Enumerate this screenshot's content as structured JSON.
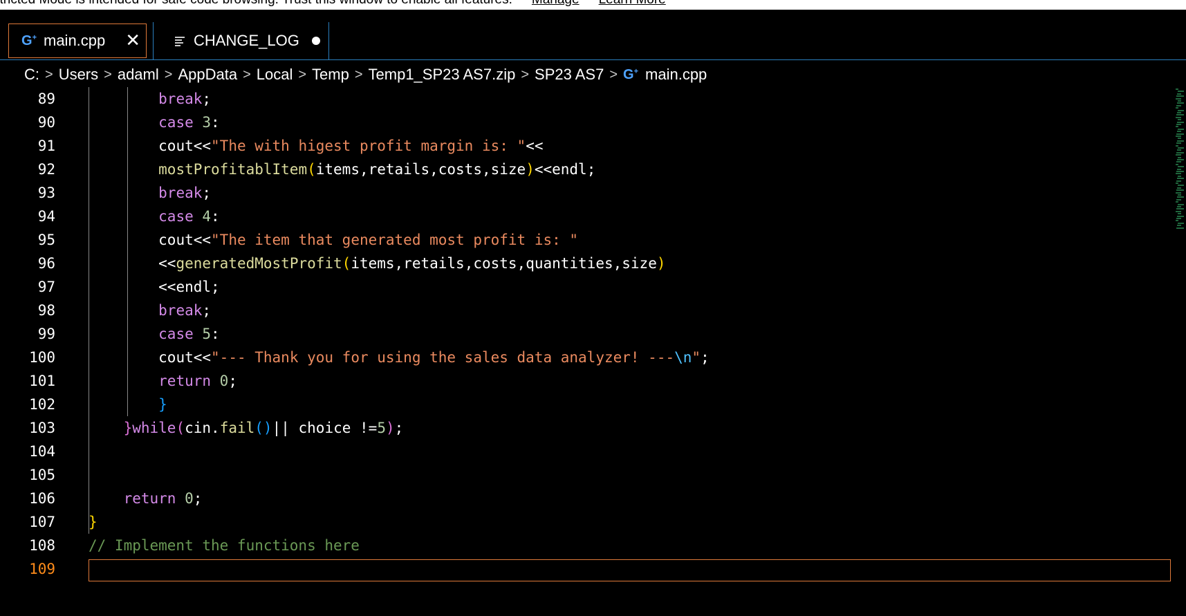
{
  "banner": {
    "message": "stricted Mode is intended for safe code browsing. Trust this window to enable all features.",
    "manage": "Manage",
    "learn_more": "Learn More"
  },
  "tabs": [
    {
      "label": "main.cpp",
      "icon": "cpp-file-icon",
      "active": true,
      "close": "✕"
    },
    {
      "label": "CHANGE_LOG",
      "icon": "text-lines-icon",
      "dirty": true
    }
  ],
  "breadcrumb": [
    "C:",
    "Users",
    "adaml",
    "AppData",
    "Local",
    "Temp",
    "Temp1_SP23 AS7.zip",
    "SP23 AS7",
    "main.cpp"
  ],
  "colors": {
    "accent_orange": "#e07a3a",
    "border_blue": "#2b7fbf",
    "keyword": "#d48ae8",
    "string": "#ea8a5f",
    "comment": "#6a9955"
  },
  "editor": {
    "current_line": 109,
    "lines": [
      {
        "n": "89",
        "tokens": [
          [
            "        ",
            "plain"
          ],
          [
            "break",
            "kw"
          ],
          [
            ";",
            "plain"
          ]
        ]
      },
      {
        "n": "90",
        "tokens": [
          [
            "        ",
            "plain"
          ],
          [
            "case",
            "kw"
          ],
          [
            " ",
            "plain"
          ],
          [
            "3",
            "num"
          ],
          [
            ":",
            "plain"
          ]
        ]
      },
      {
        "n": "91",
        "tokens": [
          [
            "        ",
            "plain"
          ],
          [
            "cout",
            "plain"
          ],
          [
            "<<",
            "plain"
          ],
          [
            "\"The with higest profit margin is: \"",
            "str"
          ],
          [
            "<<",
            "plain"
          ]
        ]
      },
      {
        "n": "92",
        "tokens": [
          [
            "        ",
            "plain"
          ],
          [
            "mostProfitablItem",
            "fn"
          ],
          [
            "(",
            "brace-y"
          ],
          [
            "items,retails,costs,size",
            "plain"
          ],
          [
            ")",
            "brace-y"
          ],
          [
            "<<endl;",
            "plain"
          ]
        ]
      },
      {
        "n": "93",
        "tokens": [
          [
            "        ",
            "plain"
          ],
          [
            "break",
            "kw"
          ],
          [
            ";",
            "plain"
          ]
        ]
      },
      {
        "n": "94",
        "tokens": [
          [
            "        ",
            "plain"
          ],
          [
            "case",
            "kw"
          ],
          [
            " ",
            "plain"
          ],
          [
            "4",
            "num"
          ],
          [
            ":",
            "plain"
          ]
        ]
      },
      {
        "n": "95",
        "tokens": [
          [
            "        ",
            "plain"
          ],
          [
            "cout",
            "plain"
          ],
          [
            "<<",
            "plain"
          ],
          [
            "\"The item that generated most profit is: \"",
            "str"
          ]
        ]
      },
      {
        "n": "96",
        "tokens": [
          [
            "        ",
            "plain"
          ],
          [
            "<<",
            "plain"
          ],
          [
            "generatedMostProfit",
            "fn"
          ],
          [
            "(",
            "brace-y"
          ],
          [
            "items,retails,costs,quantities,size",
            "plain"
          ],
          [
            ")",
            "brace-y"
          ]
        ]
      },
      {
        "n": "97",
        "tokens": [
          [
            "        ",
            "plain"
          ],
          [
            "<<endl;",
            "plain"
          ]
        ]
      },
      {
        "n": "98",
        "tokens": [
          [
            "        ",
            "plain"
          ],
          [
            "break",
            "kw"
          ],
          [
            ";",
            "plain"
          ]
        ]
      },
      {
        "n": "99",
        "tokens": [
          [
            "        ",
            "plain"
          ],
          [
            "case",
            "kw"
          ],
          [
            " ",
            "plain"
          ],
          [
            "5",
            "num"
          ],
          [
            ":",
            "plain"
          ]
        ]
      },
      {
        "n": "100",
        "tokens": [
          [
            "        ",
            "plain"
          ],
          [
            "cout",
            "plain"
          ],
          [
            "<<",
            "plain"
          ],
          [
            "\"--- Thank you for using the sales data analyzer! ---",
            "str"
          ],
          [
            "\\n",
            "esc"
          ],
          [
            "\"",
            "str"
          ],
          [
            ";",
            "plain"
          ]
        ]
      },
      {
        "n": "101",
        "tokens": [
          [
            "        ",
            "plain"
          ],
          [
            "return",
            "kw"
          ],
          [
            " ",
            "plain"
          ],
          [
            "0",
            "num"
          ],
          [
            ";",
            "plain"
          ]
        ]
      },
      {
        "n": "102",
        "tokens": [
          [
            "        ",
            "plain"
          ],
          [
            "}",
            "brace-b"
          ]
        ]
      },
      {
        "n": "103",
        "tokens": [
          [
            "    ",
            "plain"
          ],
          [
            "}",
            "brace-p"
          ],
          [
            "while",
            "kw"
          ],
          [
            "(",
            "brace-p"
          ],
          [
            "cin",
            "plain"
          ],
          [
            ".",
            "plain"
          ],
          [
            "fail",
            "fn"
          ],
          [
            "()",
            "brace-b"
          ],
          [
            "||",
            "plain"
          ],
          [
            " choice !=",
            "plain"
          ],
          [
            "5",
            "num"
          ],
          [
            ")",
            "brace-p"
          ],
          [
            ";",
            "plain"
          ]
        ]
      },
      {
        "n": "104",
        "tokens": []
      },
      {
        "n": "105",
        "tokens": []
      },
      {
        "n": "106",
        "tokens": [
          [
            "    ",
            "plain"
          ],
          [
            "return",
            "kw"
          ],
          [
            " ",
            "plain"
          ],
          [
            "0",
            "num"
          ],
          [
            ";",
            "plain"
          ]
        ]
      },
      {
        "n": "107",
        "tokens": [
          [
            "}",
            "brace-y"
          ]
        ]
      },
      {
        "n": "108",
        "tokens": [
          [
            "// Implement the functions here",
            "cmt"
          ]
        ]
      },
      {
        "n": "109",
        "tokens": []
      }
    ]
  }
}
